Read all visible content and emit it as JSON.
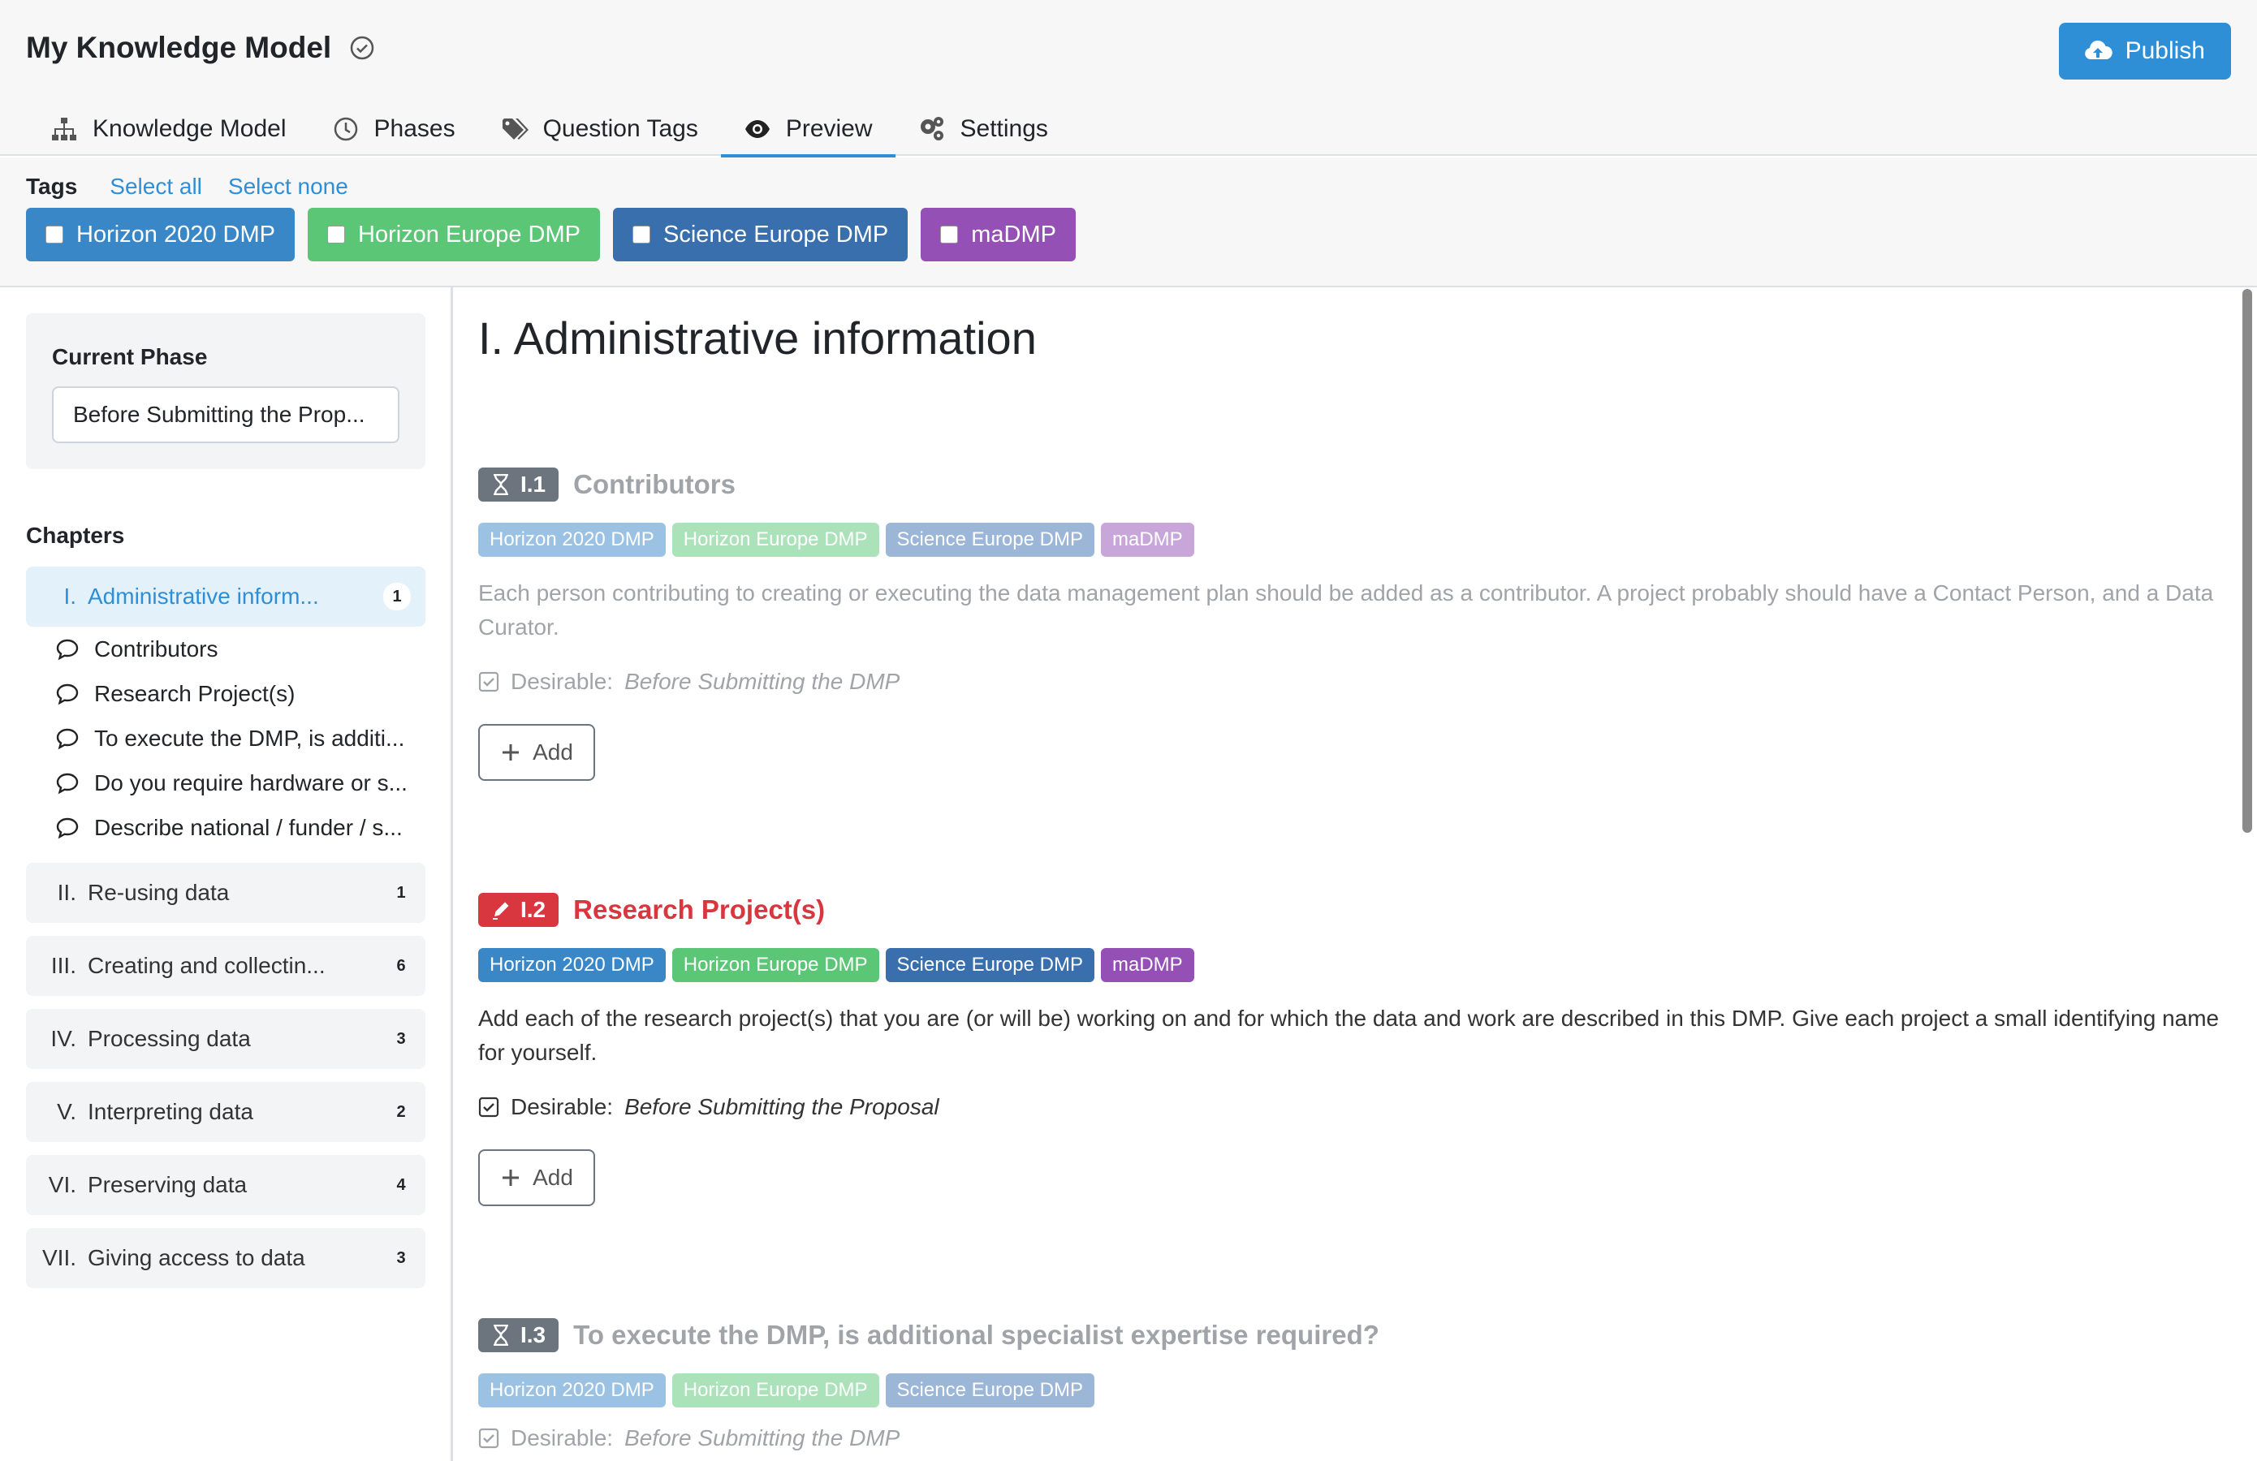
{
  "header": {
    "title": "My Knowledge Model",
    "publish_label": "Publish",
    "tabs": [
      {
        "label": "Knowledge Model",
        "icon": "sitemap-icon"
      },
      {
        "label": "Phases",
        "icon": "clock-icon"
      },
      {
        "label": "Question Tags",
        "icon": "tags-icon"
      },
      {
        "label": "Preview",
        "icon": "eye-icon",
        "active": true
      },
      {
        "label": "Settings",
        "icon": "gears-icon"
      }
    ]
  },
  "tagbar": {
    "label": "Tags",
    "select_all": "Select all",
    "select_none": "Select none",
    "tags": [
      {
        "label": "Horizon 2020 DMP",
        "color": "#3a87c8"
      },
      {
        "label": "Horizon Europe DMP",
        "color": "#5bc776"
      },
      {
        "label": "Science Europe DMP",
        "color": "#3a6fae"
      },
      {
        "label": "maDMP",
        "color": "#9450b5"
      }
    ]
  },
  "sidebar": {
    "phase_label": "Current Phase",
    "phase_value": "Before Submitting the Prop...",
    "chapters_label": "Chapters",
    "chapters": [
      {
        "num": "I.",
        "title": "Administrative inform...",
        "count": "1",
        "active": true
      },
      {
        "num": "II.",
        "title": "Re-using data",
        "count": "1"
      },
      {
        "num": "III.",
        "title": "Creating and collectin...",
        "count": "6"
      },
      {
        "num": "IV.",
        "title": "Processing data",
        "count": "3"
      },
      {
        "num": "V.",
        "title": "Interpreting data",
        "count": "2"
      },
      {
        "num": "VI.",
        "title": "Preserving data",
        "count": "4"
      },
      {
        "num": "VII.",
        "title": "Giving access to data",
        "count": "3"
      }
    ],
    "questions": [
      "Contributors",
      "Research Project(s)",
      "To execute the DMP, is additi...",
      "Do you require hardware or s...",
      "Describe national / funder / s..."
    ]
  },
  "main": {
    "title": "I. Administrative information",
    "questions": [
      {
        "number": "I.1",
        "badge_icon": "hourglass-icon",
        "badge_color": "#6c757d",
        "title": "Contributors",
        "title_color": "#a0a4a8",
        "tags": [
          "Horizon 2020 DMP",
          "Horizon Europe DMP",
          "Science Europe DMP",
          "maDMP"
        ],
        "text": "Each person contributing to creating or executing the data management plan should be added as a contributor. A project probably should have a Contact Person, and a Data Curator.",
        "desirable_label": "Desirable:",
        "desirable_value": "Before Submitting the DMP",
        "add_label": "Add"
      },
      {
        "number": "I.2",
        "badge_icon": "pencil-icon",
        "badge_color": "#d9373f",
        "title": "Research Project(s)",
        "title_color": "#d9373f",
        "tags": [
          "Horizon 2020 DMP",
          "Horizon Europe DMP",
          "Science Europe DMP",
          "maDMP"
        ],
        "text": "Add each of the research project(s) that you are (or will be) working on and for which the data and work are described in this DMP. Give each project a small identifying name for yourself.",
        "desirable_label": "Desirable:",
        "desirable_value": "Before Submitting the Proposal",
        "add_label": "Add"
      },
      {
        "number": "I.3",
        "badge_icon": "hourglass-icon",
        "badge_color": "#6c757d",
        "title": "To execute the DMP, is additional specialist expertise required?",
        "title_color": "#a0a4a8",
        "tags": [
          "Horizon 2020 DMP",
          "Horizon Europe DMP",
          "Science Europe DMP"
        ],
        "desirable_label": "Desirable:",
        "desirable_value": "Before Submitting the DMP"
      }
    ]
  }
}
